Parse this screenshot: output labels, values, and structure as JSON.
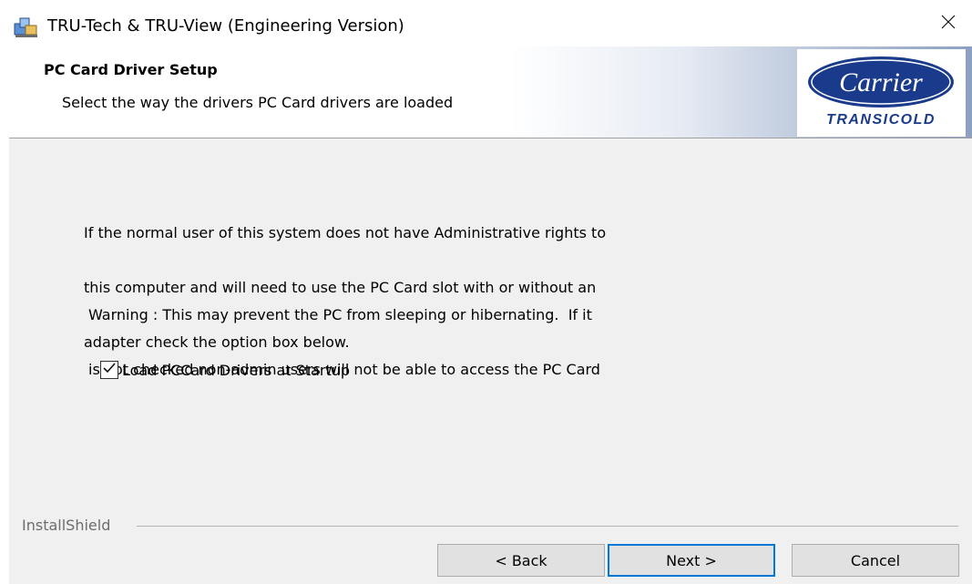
{
  "window": {
    "title": "TRU-Tech & TRU-View (Engineering Version)"
  },
  "header": {
    "title": "PC Card Driver Setup",
    "subtitle": "Select the way the drivers PC Card drivers are loaded",
    "logo": {
      "brand": "Carrier",
      "division": "TRANSICOLD",
      "color": "#1a3a8c"
    }
  },
  "body": {
    "paragraph1": [
      "If the normal user of this system does not have Administrative rights to",
      "this computer and will need to use the PC Card slot with or without an",
      "adapter check the option box below."
    ],
    "paragraph2": [
      "Warning : This may prevent the PC from sleeping or hibernating.  If it",
      "is not checked non-admin users will not be able to access the PC Card"
    ],
    "checkbox": {
      "label": "Load PCCard Drivers at Startup",
      "checked": true
    }
  },
  "footer": {
    "brand": "InstallShield",
    "back_label": "< Back",
    "next_label": "Next >",
    "cancel_label": "Cancel"
  },
  "icons": {
    "app": "installer-icon",
    "close": "close-icon",
    "check": "checkmark-icon"
  },
  "colors": {
    "accent": "#0078d7",
    "window_bg": "#f0f0f0"
  }
}
